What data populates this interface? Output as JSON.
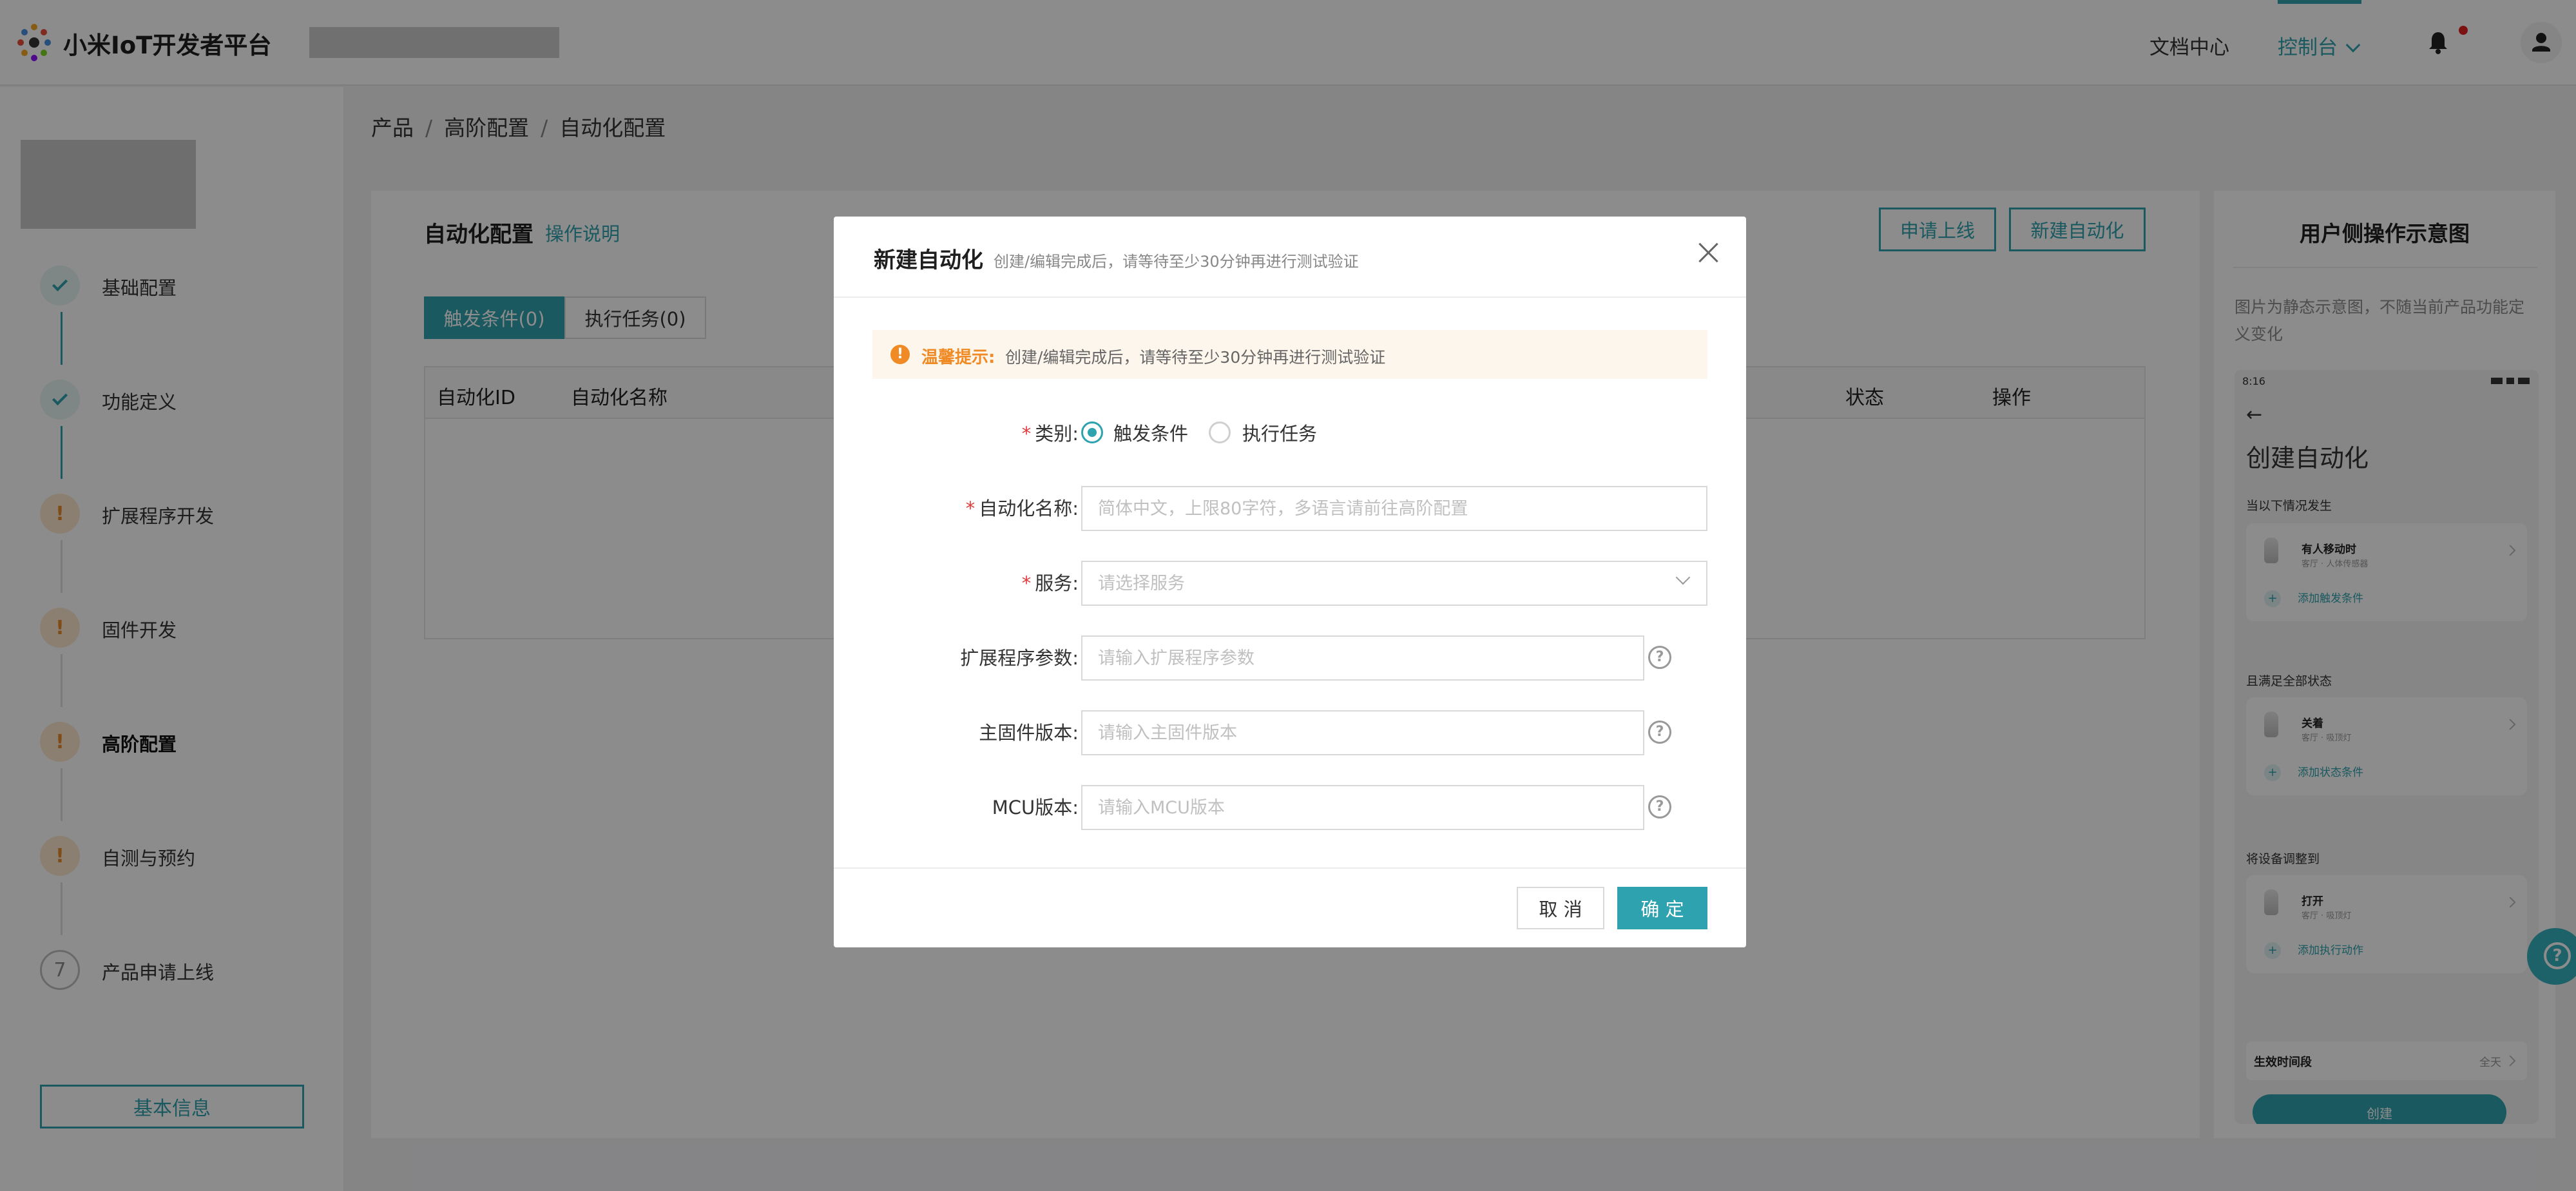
{
  "header": {
    "brand": "小米IoT开发者平台",
    "nav_docs": "文档中心",
    "nav_console": "控制台"
  },
  "breadcrumb": [
    "产品",
    "高阶配置",
    "自动化配置"
  ],
  "sidebar": {
    "steps": [
      {
        "label": "基础配置",
        "status": "done"
      },
      {
        "label": "功能定义",
        "status": "done"
      },
      {
        "label": "扩展程序开发",
        "status": "warn",
        "mark": "!"
      },
      {
        "label": "固件开发",
        "status": "warn",
        "mark": "!"
      },
      {
        "label": "高阶配置",
        "status": "warn",
        "mark": "!",
        "active": true
      },
      {
        "label": "自测与预约",
        "status": "warn",
        "mark": "!"
      },
      {
        "label": "产品申请上线",
        "status": "todo",
        "mark": "7"
      }
    ],
    "basic_info_button": "基本信息"
  },
  "main": {
    "title": "自动化配置",
    "help_link": "操作说明",
    "apply_button": "申请上线",
    "new_button": "新建自动化",
    "tabs": [
      {
        "label": "触发条件(0)",
        "active": true
      },
      {
        "label": "执行任务(0)",
        "active": false
      }
    ],
    "columns": [
      "自动化ID",
      "自动化名称",
      "状态",
      "操作"
    ]
  },
  "preview": {
    "title": "用户侧操作示意图",
    "desc": "图片为静态示意图，不随当前产品功能定义变化",
    "phone": {
      "time": "8:16",
      "back": "←",
      "title": "创建自动化",
      "sec1": "当以下情况发生",
      "item1_title": "有人移动时",
      "item1_sub": "客厅 · 人体传感器",
      "add1": "添加触发条件",
      "sec2": "且满足全部状态",
      "item2_title": "关着",
      "item2_sub": "客厅 · 吸顶灯",
      "add2": "添加状态条件",
      "sec3": "将设备调整到",
      "item3_title": "打开",
      "item3_sub": "客厅 · 吸顶灯",
      "add3": "添加执行动作",
      "period_label": "生效时间段",
      "period_value": "全天",
      "create_button": "创建"
    }
  },
  "modal": {
    "title": "新建自动化",
    "subtitle": "创建/编辑完成后，请等待至少30分钟再进行测试验证",
    "notice_label": "温馨提示:",
    "notice_text": "创建/编辑完成后，请等待至少30分钟再进行测试验证",
    "type_label": "类别:",
    "type_options": [
      {
        "label": "触发条件",
        "checked": true
      },
      {
        "label": "执行任务",
        "checked": false
      }
    ],
    "name_label": "自动化名称:",
    "name_placeholder": "简体中文，上限80字符，多语言请前往高阶配置",
    "service_label": "服务:",
    "service_placeholder": "请选择服务",
    "ext_label": "扩展程序参数:",
    "ext_placeholder": "请输入扩展程序参数",
    "fw_label": "主固件版本:",
    "fw_placeholder": "请输入主固件版本",
    "mcu_label": "MCU版本:",
    "mcu_placeholder": "请输入MCU版本",
    "cancel_button": "取 消",
    "ok_button": "确 定"
  },
  "colors": {
    "accent": "#2ea2ae",
    "warning": "#f08a24",
    "required": "#e23b3b"
  }
}
